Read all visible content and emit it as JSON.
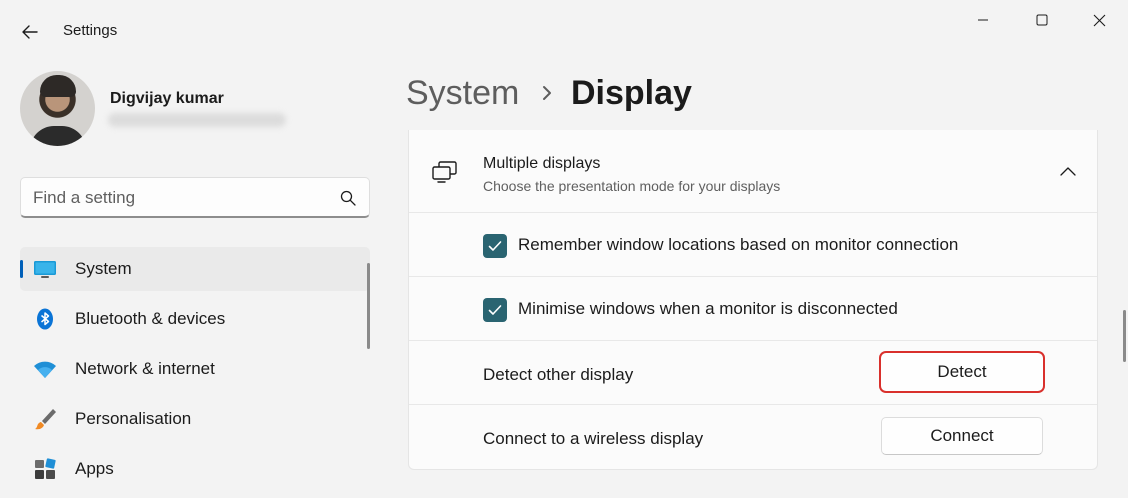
{
  "window": {
    "title": "Settings",
    "controls": [
      "minimize",
      "maximize",
      "close"
    ]
  },
  "profile": {
    "name": "Digvijay kumar"
  },
  "search": {
    "placeholder": "Find a setting",
    "value": ""
  },
  "sidebar": {
    "items": [
      {
        "label": "System",
        "icon": "monitor-icon",
        "active": true
      },
      {
        "label": "Bluetooth & devices",
        "icon": "bluetooth-icon",
        "active": false
      },
      {
        "label": "Network & internet",
        "icon": "wifi-icon",
        "active": false
      },
      {
        "label": "Personalisation",
        "icon": "paintbrush-icon",
        "active": false
      },
      {
        "label": "Apps",
        "icon": "apps-icon",
        "active": false
      }
    ]
  },
  "breadcrumb": {
    "parent": "System",
    "current": "Display"
  },
  "section": {
    "title": "Multiple displays",
    "subtitle": "Choose the presentation mode for your displays",
    "expanded": true,
    "options": [
      {
        "label": "Remember window locations based on monitor connection",
        "checked": true
      },
      {
        "label": "Minimise windows when a monitor is disconnected",
        "checked": true
      }
    ],
    "detect": {
      "label": "Detect other display",
      "button": "Detect",
      "highlighted": true
    },
    "wireless": {
      "label": "Connect to a wireless display",
      "button": "Connect"
    }
  },
  "colors": {
    "accent": "#005fb8",
    "checkbox": "#2a6471",
    "highlight_outline": "#d9302c",
    "background": "#f3f3f3",
    "card": "#fbfbfb"
  }
}
